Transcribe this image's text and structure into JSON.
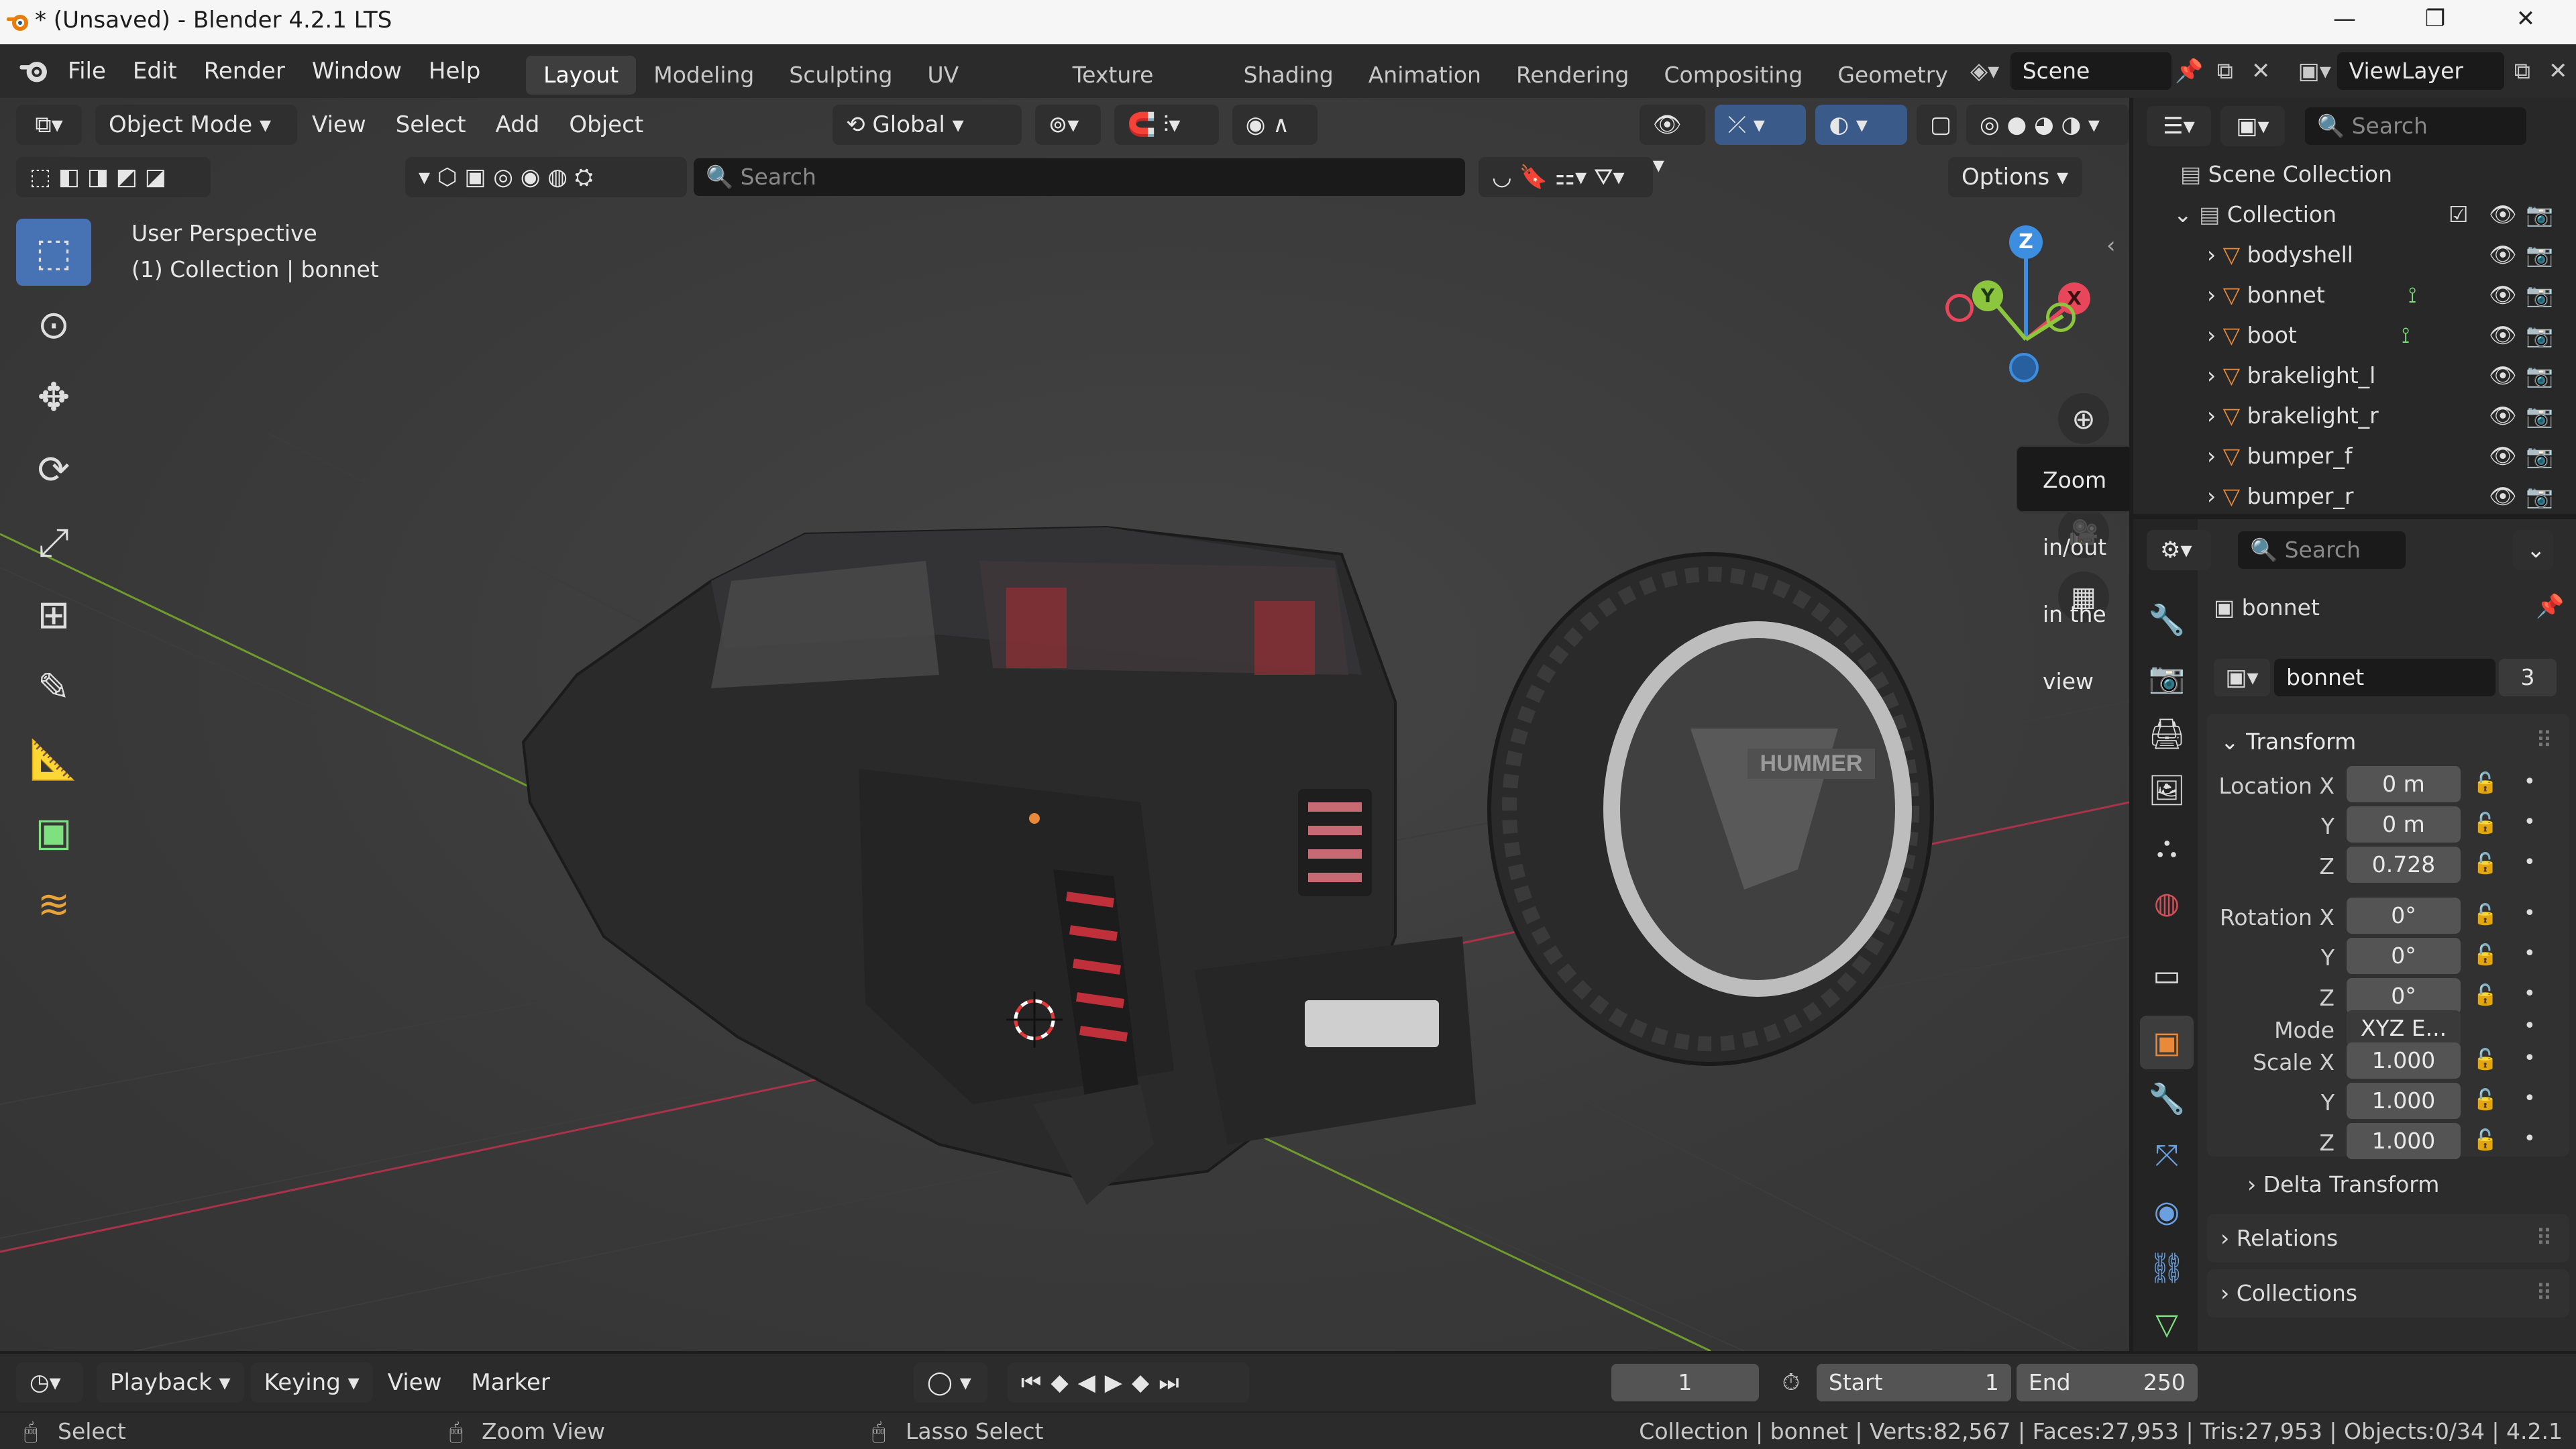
{
  "window": {
    "title": "* (Unsaved) - Blender 4.2.1 LTS",
    "minimize": "—",
    "maximize": "❐",
    "close": "✕"
  },
  "menu": [
    "File",
    "Edit",
    "Render",
    "Window",
    "Help"
  ],
  "workspaces": [
    "Layout",
    "Modeling",
    "Sculpting",
    "UV Editing",
    "Texture Paint",
    "Shading",
    "Animation",
    "Rendering",
    "Compositing",
    "Geometry N"
  ],
  "scene": {
    "name": "Scene",
    "view_layer": "ViewLayer"
  },
  "viewport_header": {
    "mode": "Object Mode",
    "menus": [
      "View",
      "Select",
      "Add",
      "Object"
    ],
    "transform_orientation": "Global",
    "search_placeholder": "Search",
    "options_label": "Options"
  },
  "viewport": {
    "perspective": "User Perspective",
    "context": "(1) Collection | bonnet",
    "tooltip": "Zoom in/out in the view",
    "axes": {
      "x": "X",
      "y": "Y",
      "z": "Z"
    },
    "wheel_brand": "HUMMER"
  },
  "toolbar_tools": [
    "select-box",
    "cursor",
    "move",
    "rotate",
    "scale",
    "transform",
    "annotate",
    "measure",
    "add-cube",
    "grease-pencil"
  ],
  "outliner": {
    "search_placeholder": "Search",
    "root": "Scene Collection",
    "collection": "Collection",
    "items": [
      "bodyshell",
      "bonnet",
      "boot",
      "brakelight_l",
      "brakelight_r",
      "bumper_f",
      "bumper_r"
    ]
  },
  "properties": {
    "search_placeholder": "Search",
    "object_name": "bonnet",
    "data_name": "bonnet",
    "data_users": "3",
    "transform_header": "Transform",
    "location": {
      "label_x": "Location X",
      "x": "0 m",
      "y": "0 m",
      "z": "0.728"
    },
    "rotation": {
      "label_x": "Rotation X",
      "x": "0°",
      "y": "0°",
      "z": "0°"
    },
    "mode_label": "Mode",
    "mode_value": "XYZ E...",
    "scale": {
      "label_x": "Scale X",
      "x": "1.000",
      "y": "1.000",
      "z": "1.000"
    },
    "axis_y": "Y",
    "axis_z": "Z",
    "delta_transform": "Delta Transform",
    "relations": "Relations",
    "collections": "Collections"
  },
  "timeline": {
    "menus": [
      "Playback",
      "Keying",
      "View",
      "Marker"
    ],
    "current_frame": "1",
    "start_label": "Start",
    "start": "1",
    "end_label": "End",
    "end": "250"
  },
  "status": {
    "select": "Select",
    "zoom_view": "Zoom View",
    "lasso": "Lasso Select",
    "stats": "Collection | bonnet | Verts:82,567 | Faces:27,953 | Tris:27,953 | Objects:0/34 | 4.2.1"
  },
  "colors": {
    "accent": "#4772b3",
    "mesh_orange": "#e88a3a",
    "x_axis": "#e8465a",
    "y_axis": "#8cc63f",
    "z_axis": "#3d8de0"
  }
}
